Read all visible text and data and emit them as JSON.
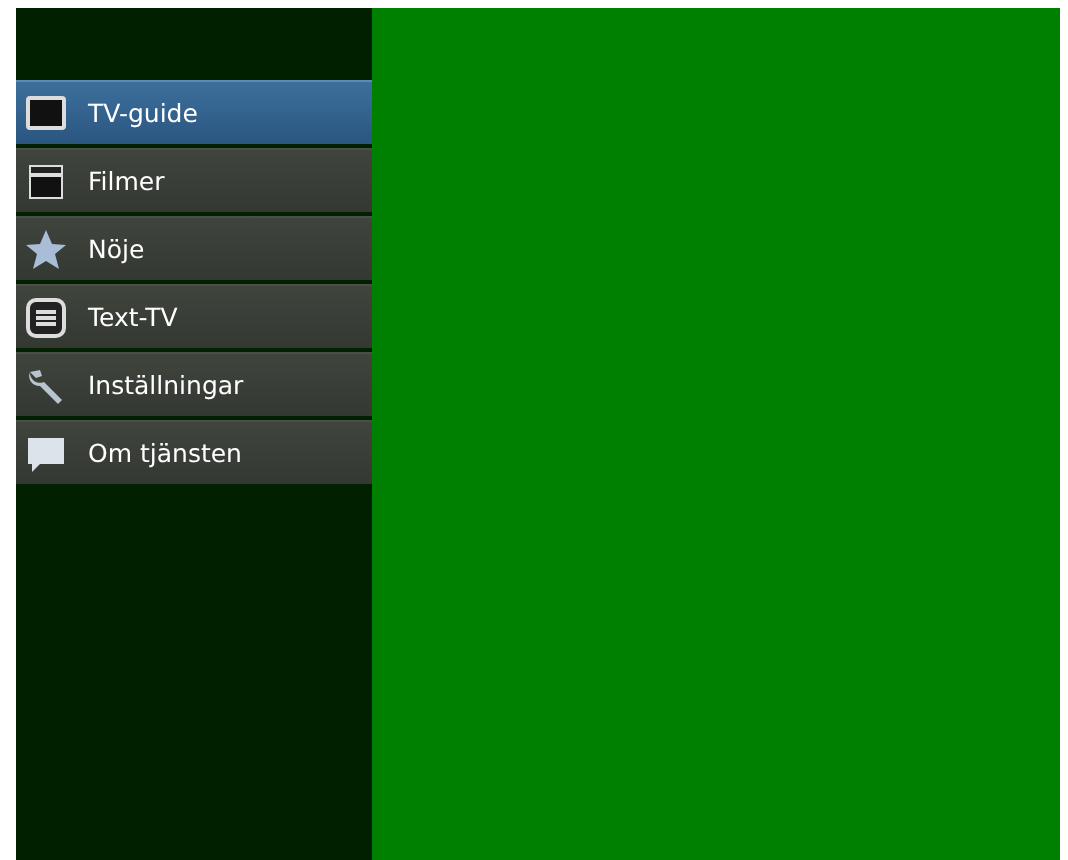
{
  "menu": [
    {
      "label": "TV-guide",
      "kind": "tv",
      "selected": true
    },
    {
      "label": "Filmer",
      "kind": "clapper",
      "selected": false
    },
    {
      "label": "Nöje",
      "kind": "star",
      "selected": false
    },
    {
      "label": "Text-TV",
      "kind": "text",
      "selected": false
    },
    {
      "label": "Inställningar",
      "kind": "wrench",
      "selected": false
    },
    {
      "label": "Om tjänsten",
      "kind": "speech",
      "selected": false
    }
  ]
}
